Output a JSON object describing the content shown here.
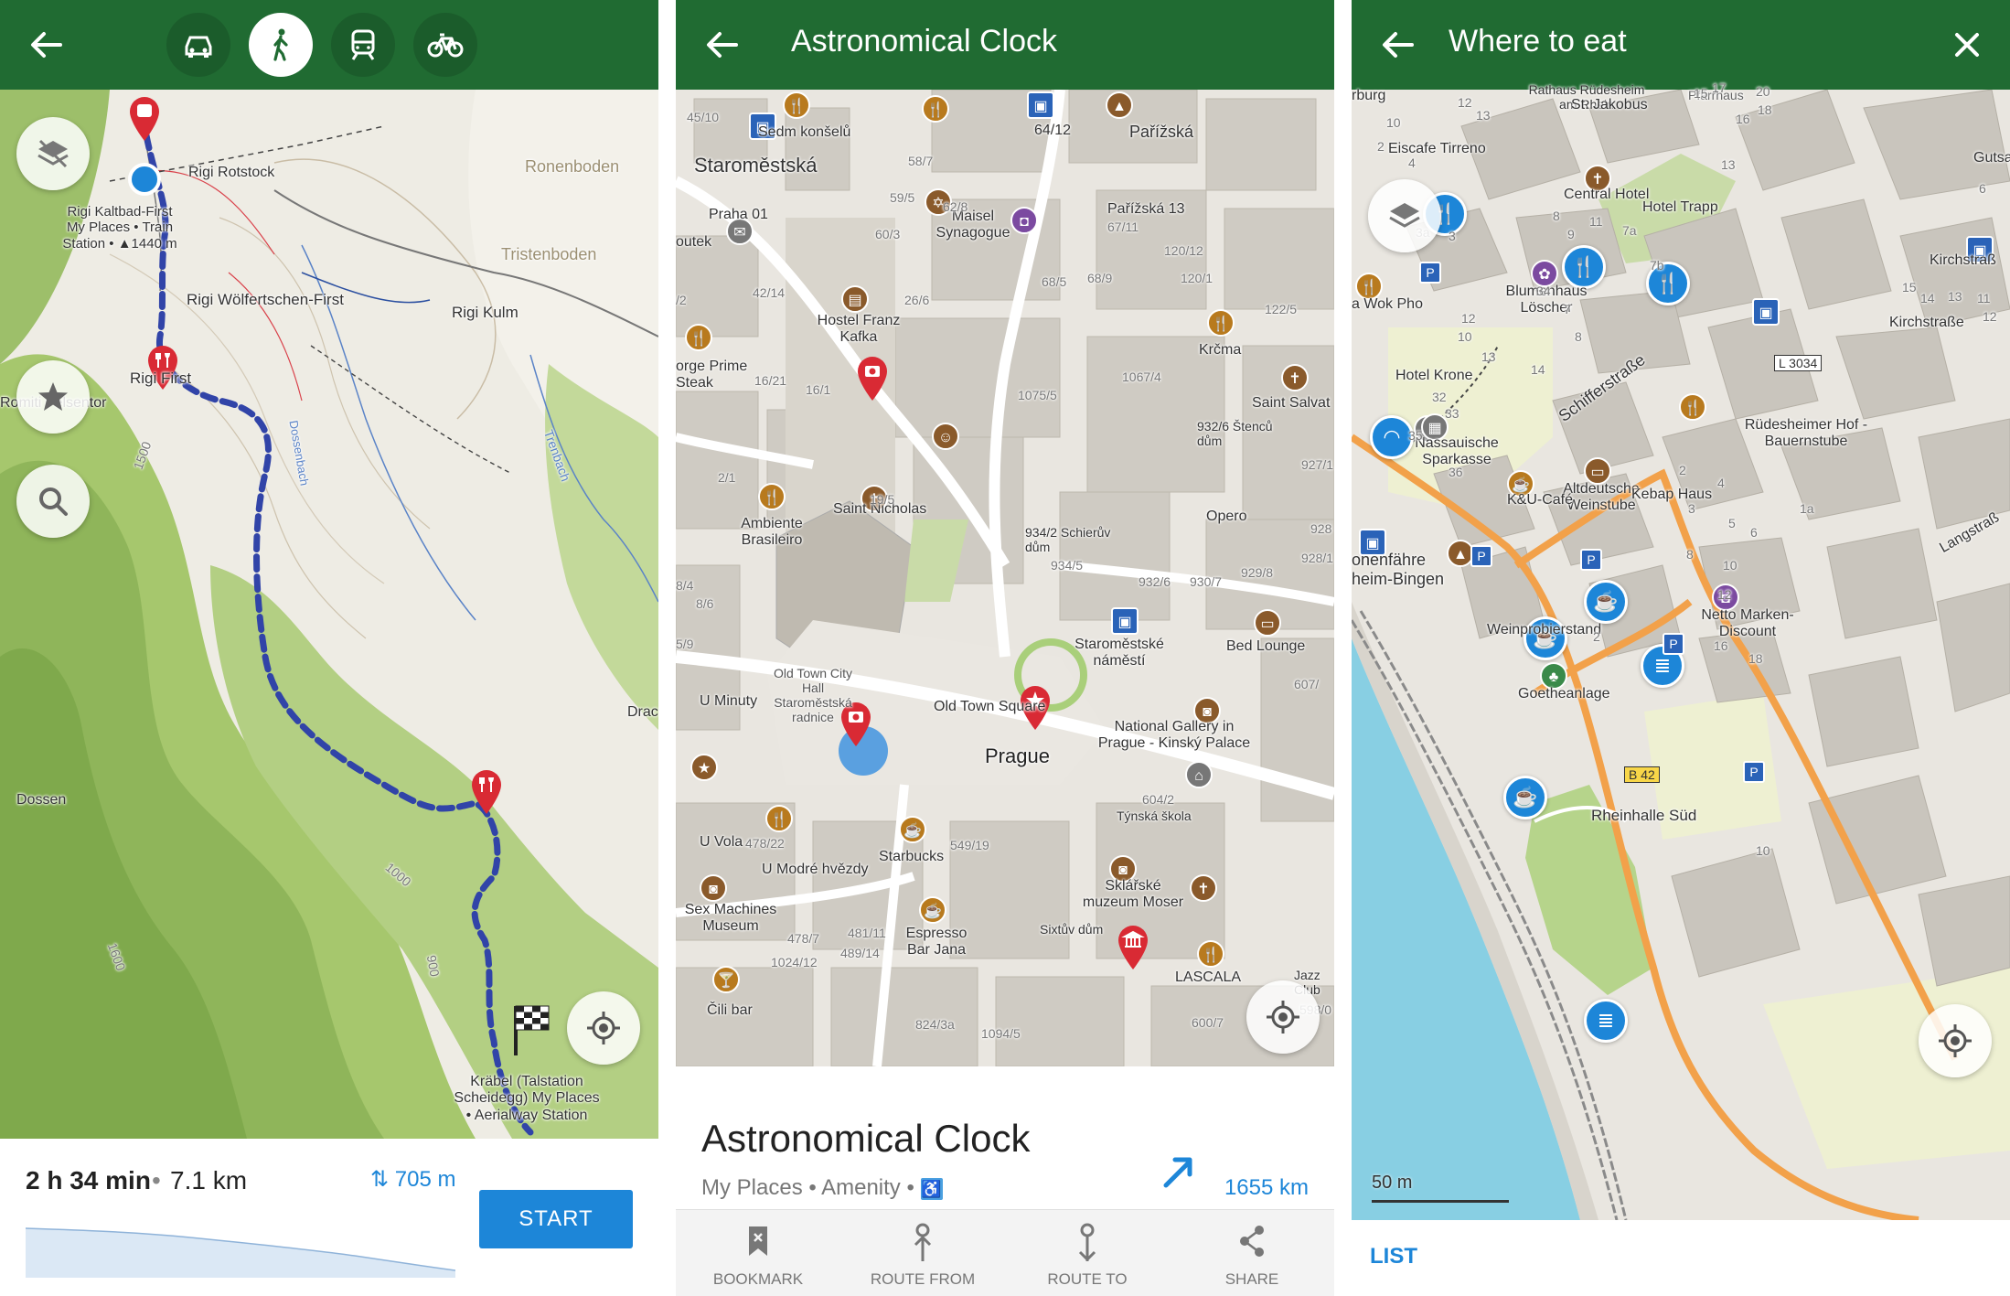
{
  "screen1": {
    "modes": [
      "car-icon",
      "walk-icon",
      "train-icon",
      "bike-icon"
    ],
    "active_mode": "walk-icon",
    "labels": {
      "rigi_station": "Rigi Kaltbad-First My Places • Train Station • ▲1440 m",
      "rigi_rotstock": "Rigi Rotstock",
      "ronenboden": "Ronenboden",
      "tristenboden": "Tristenboden",
      "woelfertschen": "Rigi Wölfertschen-First",
      "rigi_kulm": "Rigi Kulm",
      "rigifirst": "Rigi First",
      "romiti": "Romiti Felsentor",
      "dossen": "Dossen",
      "drac": "Drac",
      "kraebel": "Kräbel (Talstation Scheidegg) My Places • Aerialway Station",
      "contour_1500": "1500",
      "contour_1000": "1000",
      "contour_900": "900",
      "contour_1600": "1600",
      "trenbach": "Trenbach",
      "dossen_bach": "Dossenbach"
    },
    "route": {
      "time": "2 h 34 min",
      "separator": "•",
      "distance": "7.1 km",
      "elevation": "705 m",
      "start_label": "START"
    }
  },
  "screen2": {
    "title": "Astronomical Clock",
    "labels": {
      "staromestska": "Staroměstská",
      "sedm_konselu": "Sedm konšelů",
      "praha01": "Praha 01",
      "outek": "outek",
      "num_6412": "64/12",
      "parizska": "Pařížská",
      "maisel": "Maisel Synagogue",
      "parizska13": "Pařížská 13",
      "hostel_franz_kafka": "Hostel Franz Kafka",
      "orge_prime": "orge Prime Steak",
      "krcma": "Krčma",
      "saint_salvat": "Saint Salvat",
      "sencuv": "932/6 Štenců dům",
      "ambiente": "Ambiente Brasileiro",
      "saint_nicholas": "Saint Nicholas",
      "opero": "Opero",
      "schieruv": "934/2 Schierův dům",
      "staromestske_namesti": "Staroměstské náměstí",
      "bed_lounge": "Bed Lounge",
      "old_town_city_hall": "Old Town City Hall Staroměstská radnice",
      "old_town_square": "Old Town Square",
      "prague": "Prague",
      "national_gallery": "National Gallery in Prague - Kinský Palace",
      "u_minuty": "U Minuty",
      "tynska": "Týnská škola",
      "u_vola": "U Vola",
      "u_modre": "U Modré hvězdy",
      "starbucks": "Starbucks",
      "sex_machines": "Sex Machines Museum",
      "espresso": "Espresso Bar Jana",
      "sklarske": "Sklářské muzeum Moser",
      "sixtuv": "Sixtův dům",
      "lascala": "LASCALA",
      "cili_bar": "Čili bar",
      "jazz_club": "Jazz Club"
    },
    "numbers": [
      "45/10",
      "58/7",
      "59/5",
      "60/3",
      "62/8",
      "67/11",
      "26/6",
      "42/14",
      "16/21",
      "16/1",
      "68/5",
      "68/9",
      "120/12",
      "120/1",
      "122/5",
      "1067/4",
      "1075/5",
      "928",
      "927/1",
      "928/1",
      "929/8",
      "932/6",
      "930/7",
      "934/5",
      "19/5",
      "2/1",
      "8/4",
      "8/6",
      "5/9",
      "607/",
      "604/2",
      "478/22",
      "549/19",
      "478/7",
      "481/11",
      "1024/12",
      "489/14",
      "824/3a",
      "1094/5",
      "600/7",
      "598/0",
      "/2"
    ],
    "detail": {
      "title": "Astronomical Clock",
      "subtitle": "My Places • Amenity •",
      "distance": "1655 km"
    },
    "actions": [
      {
        "label": "BOOKMARK",
        "icon": "bookmark-icon"
      },
      {
        "label": "ROUTE FROM",
        "icon": "route-from-icon"
      },
      {
        "label": "ROUTE TO",
        "icon": "route-to-icon"
      },
      {
        "label": "SHARE",
        "icon": "share-icon"
      }
    ]
  },
  "screen3": {
    "title": "Where to eat",
    "labels": {
      "rathaus": "Rathaus Rüdesheim am Rhein",
      "st_jakobus": "St. Jakobus",
      "pfarrhaus": "Pfarrhaus",
      "eiscafe": "Eiscafe Tirreno",
      "central_hotel": "Central Hotel",
      "hotel_trapp": "Hotel Trapp",
      "gutsau": "Gutsau",
      "kirchstrasse1": "Kirchstraß",
      "kirchstrasse2": "Kirchstraße",
      "blumenhaus": "Blumenhaus Löscher",
      "wok_pho": "a Wok Pho",
      "hotel_krone": "Hotel Krone",
      "l3034": "L 3034",
      "schifferstrasse": "Schifferstraße",
      "nassauische": "Nassauische Sparkasse",
      "ruedesheimer": "Rüdesheimer Hof - Bauernstube",
      "altdeutsche": "Altdeutsche Weinstube",
      "kebap": "Kebap Haus",
      "ku_cafe": "K&U-Café",
      "langstr": "Langstraß",
      "faehre": "onenfähre heim-Bingen",
      "weinprobier": "Weinprobierstand",
      "netto": "Netto Marken-Discount",
      "goetheanlage": "Goetheanlage",
      "b42": "B 42",
      "rheinhalle": "Rheinhalle Süd",
      "rburg": "rburg"
    },
    "numbers": [
      "12",
      "10",
      "4",
      "2",
      "13",
      "3a",
      "3",
      "8",
      "11",
      "9",
      "7a",
      "7b",
      "15",
      "17",
      "20",
      "18",
      "16",
      "13",
      "6",
      "12",
      "10",
      "13",
      "14",
      "32",
      "33",
      "36",
      "35",
      "34",
      "7",
      "8",
      "2",
      "4",
      "3",
      "5",
      "6",
      "8",
      "10",
      "12",
      "16",
      "18",
      "2",
      "1a",
      "10",
      "11",
      "12",
      "13",
      "14",
      "15"
    ],
    "scale": "50 m",
    "list_label": "LIST"
  }
}
